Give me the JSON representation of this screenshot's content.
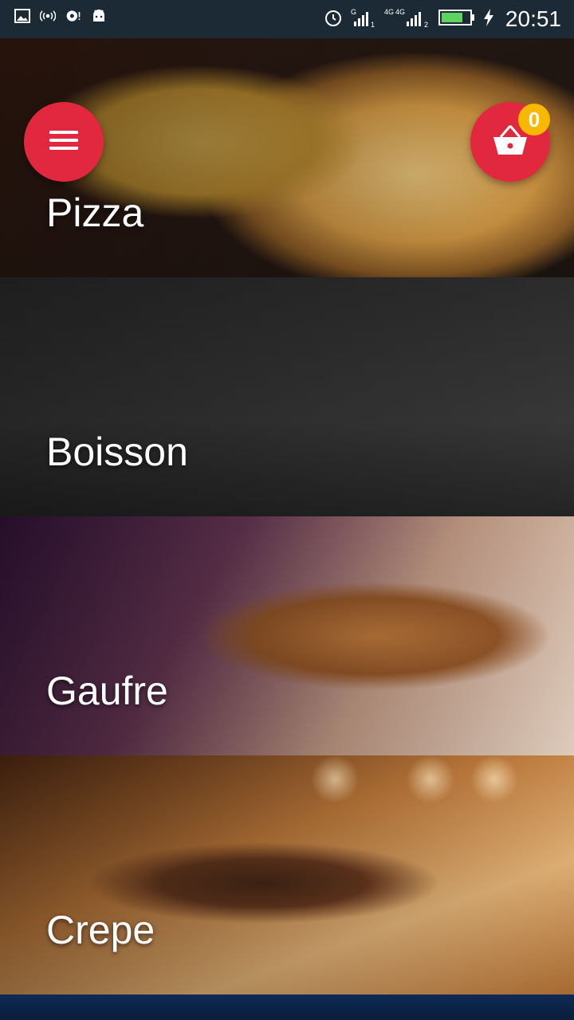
{
  "status_bar": {
    "time": "20:51",
    "icons": [
      "image-icon",
      "hotspot-icon",
      "sync-icon",
      "android-icon",
      "alarm-icon",
      "signal-1-icon",
      "signal-2-icon",
      "battery-icon",
      "charging-icon"
    ]
  },
  "header": {
    "menu_icon": "hamburger-icon",
    "cart_icon": "basket-icon",
    "cart_count": "0",
    "accent_color": "#e2283f",
    "badge_color": "#f7b800"
  },
  "categories": [
    {
      "label": "Pizza"
    },
    {
      "label": "Boisson"
    },
    {
      "label": "Gaufre"
    },
    {
      "label": "Crepe"
    }
  ]
}
